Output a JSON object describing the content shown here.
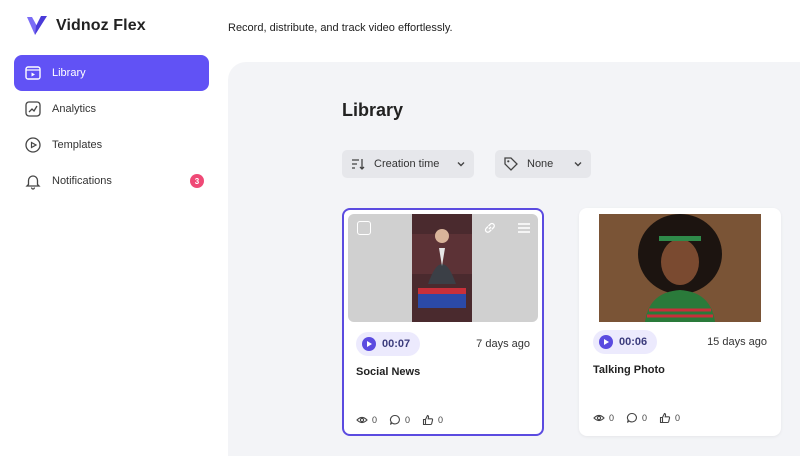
{
  "app": {
    "name": "Vidnoz Flex",
    "tagline": "Record, distribute, and track video effortlessly.",
    "accent": "#6152f5"
  },
  "sidebar": {
    "items": [
      {
        "label": "Library",
        "icon": "library-icon",
        "active": true
      },
      {
        "label": "Analytics",
        "icon": "analytics-icon",
        "active": false
      },
      {
        "label": "Templates",
        "icon": "templates-icon",
        "active": false
      },
      {
        "label": "Notifications",
        "icon": "bell-icon",
        "active": false,
        "badge": "3"
      }
    ]
  },
  "main": {
    "title": "Library",
    "sort": {
      "label": "Creation time",
      "icon": "sort-icon"
    },
    "tag": {
      "label": "None",
      "icon": "tag-icon"
    },
    "cards": [
      {
        "title": "Social News",
        "duration": "00:07",
        "age": "7 days ago",
        "views": "0",
        "comments": "0",
        "likes": "0",
        "thumbnail": "news-anchor-thumbnail",
        "selected": true
      },
      {
        "title": "Talking Photo",
        "duration": "00:06",
        "age": "15 days ago",
        "views": "0",
        "comments": "0",
        "likes": "0",
        "thumbnail": "portrait-photo-thumbnail",
        "selected": false
      }
    ]
  }
}
